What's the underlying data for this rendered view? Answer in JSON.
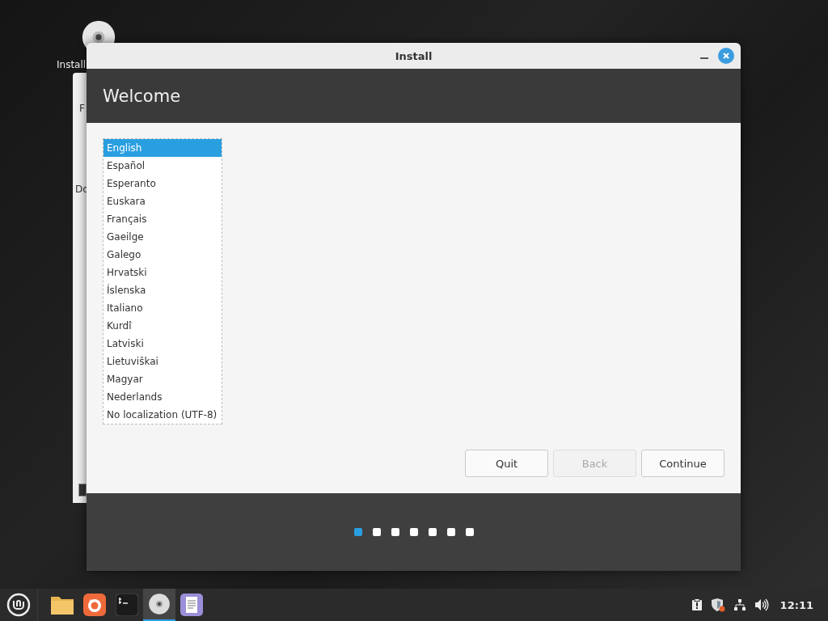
{
  "desktop": {
    "icon_label": "Install"
  },
  "background_window": {
    "title": "F",
    "label": "Do"
  },
  "window": {
    "title": "Install",
    "header": "Welcome",
    "languages": [
      {
        "label": "English",
        "selected": true
      },
      {
        "label": "Español",
        "selected": false
      },
      {
        "label": "Esperanto",
        "selected": false
      },
      {
        "label": "Euskara",
        "selected": false
      },
      {
        "label": "Français",
        "selected": false
      },
      {
        "label": "Gaeilge",
        "selected": false
      },
      {
        "label": "Galego",
        "selected": false
      },
      {
        "label": "Hrvatski",
        "selected": false
      },
      {
        "label": "Íslenska",
        "selected": false
      },
      {
        "label": "Italiano",
        "selected": false
      },
      {
        "label": "Kurdî",
        "selected": false
      },
      {
        "label": "Latviski",
        "selected": false
      },
      {
        "label": "Lietuviškai",
        "selected": false
      },
      {
        "label": "Magyar",
        "selected": false
      },
      {
        "label": "Nederlands",
        "selected": false
      },
      {
        "label": "No localization (UTF-8)",
        "selected": false
      }
    ],
    "buttons": [
      {
        "label": "Quit",
        "disabled": false
      },
      {
        "label": "Back",
        "disabled": true
      },
      {
        "label": "Continue",
        "disabled": false
      }
    ],
    "steps": [
      {
        "selected": true
      },
      {
        "selected": false
      },
      {
        "selected": false
      },
      {
        "selected": false
      },
      {
        "selected": false
      },
      {
        "selected": false
      },
      {
        "selected": false
      }
    ]
  },
  "taskbar": {
    "launchers": [
      {
        "kind": "folder",
        "active": false
      },
      {
        "kind": "browser",
        "active": false
      },
      {
        "kind": "terminal",
        "active": false
      },
      {
        "kind": "disc",
        "active": true
      },
      {
        "kind": "document",
        "active": false
      }
    ],
    "tray": [
      {
        "kind": "clipboard"
      },
      {
        "kind": "shield"
      },
      {
        "kind": "network"
      },
      {
        "kind": "volume"
      }
    ],
    "clock": "12:11"
  }
}
